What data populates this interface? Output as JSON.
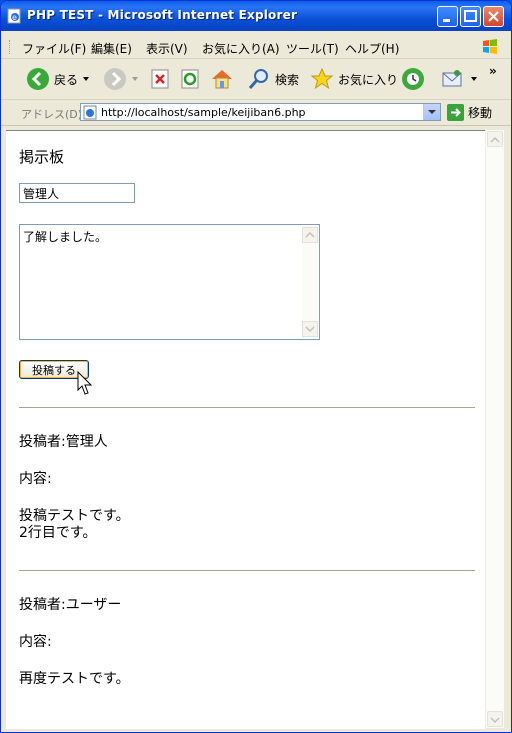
{
  "window": {
    "title": "PHP TEST - Microsoft Internet Explorer"
  },
  "menu": {
    "items": [
      "ファイル(F)",
      "編集(E)",
      "表示(V)",
      "お気に入り(A)",
      "ツール(T)",
      "ヘルプ(H)"
    ]
  },
  "toolbar": {
    "back_label": "戻る",
    "search_label": "検索",
    "favorites_label": "お気に入り",
    "overflow_label": "»"
  },
  "address": {
    "label": "アドレス(D)",
    "url": "http://localhost/sample/keijiban6.php",
    "go_label": "移動"
  },
  "page": {
    "title": "掲示板",
    "name_input_value": "管理人",
    "message_value": "了解しました。",
    "submit_label": "投稿する",
    "posts": [
      {
        "author": "投稿者:管理人",
        "content_label": "内容:",
        "lines": [
          "投稿テストです。",
          "2行目です。"
        ]
      },
      {
        "author": "投稿者:ユーザー",
        "content_label": "内容:",
        "lines": [
          "再度テストです。"
        ]
      }
    ]
  },
  "colors": {
    "titlebar": "#0a5fe8",
    "window_bg": "#ece9d8",
    "hr": "#a8a58f"
  }
}
